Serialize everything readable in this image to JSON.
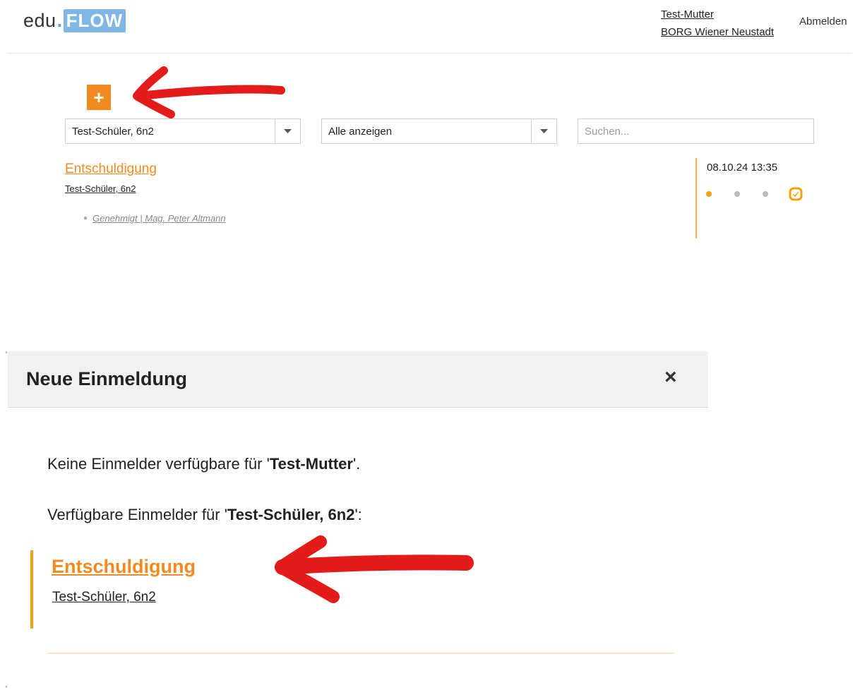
{
  "header": {
    "logo_prefix": "edu",
    "logo_dot": ".",
    "logo_suffix": "FLOW",
    "user_name": "Test-Mutter",
    "school_name": "BORG Wiener Neustadt",
    "logout_label": "Abmelden"
  },
  "toolbar": {
    "add_label": "+",
    "student_filter": "Test-Schüler, 6n2",
    "type_filter": "Alle anzeigen",
    "search_placeholder": "Suchen..."
  },
  "list": {
    "items": [
      {
        "title": "Entschuldigung",
        "student": "Test-Schüler, 6n2",
        "status": "Genehmigt | Mag. Peter Altmann",
        "date": "08.10.24 13:35",
        "progress_total": 4,
        "progress_active_index": 0
      }
    ]
  },
  "modal": {
    "title": "Neue Einmeldung",
    "close_label": "×",
    "no_reporter_prefix": "Keine Einmelder verfügbare für '",
    "no_reporter_name": "Test-Mutter",
    "no_reporter_suffix": "'.",
    "available_prefix": "Verfügbare Einmelder für '",
    "available_name": "Test-Schüler, 6n2",
    "available_suffix": "':",
    "entries": [
      {
        "title": "Entschuldigung",
        "student": "Test-Schüler, 6n2"
      }
    ]
  },
  "colors": {
    "accent_orange": "#f28a1f",
    "status_yellow": "#f5a20a",
    "logo_blue": "#7fb6e3",
    "annotation_red": "#e31b1b"
  }
}
